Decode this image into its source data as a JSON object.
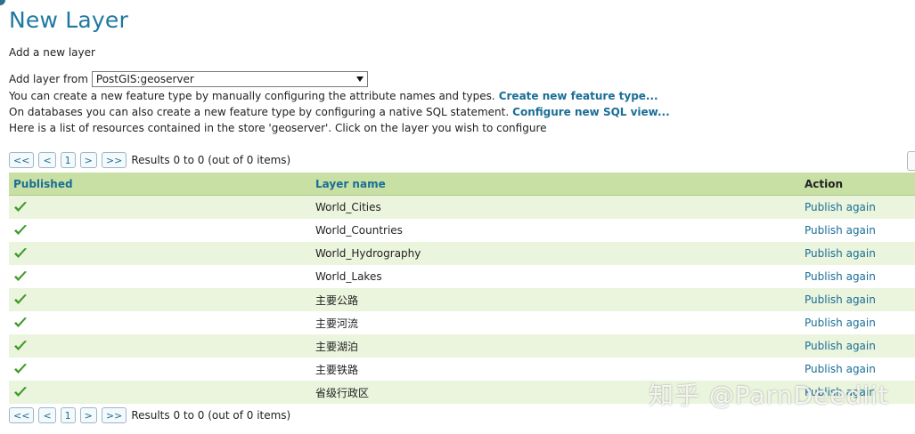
{
  "page": {
    "title": "New Layer",
    "subtitle": "Add a new layer"
  },
  "add_from": {
    "label": "Add layer from",
    "selected_store": "PostGIS:geoserver"
  },
  "info": {
    "line1_text": "You can create a new feature type by manually configuring the attribute names and types.",
    "line1_link": "Create new feature type...",
    "line2_text": "On databases you can also create a new feature type by configuring a native SQL statement.",
    "line2_link": "Configure new SQL view...",
    "line3_text": "Here is a list of resources contained in the store 'geoserver'. Click on the layer you wish to configure"
  },
  "pager": {
    "first": "<<",
    "prev": "<",
    "page": "1",
    "next": ">",
    "last": ">>",
    "results": "Results 0 to 0 (out of 0 items)"
  },
  "table": {
    "headers": [
      "Published",
      "Layer name",
      "Action"
    ],
    "rows": [
      {
        "name": "World_Cities",
        "action": "Publish again"
      },
      {
        "name": "World_Countries",
        "action": "Publish again"
      },
      {
        "name": "World_Hydrography",
        "action": "Publish again"
      },
      {
        "name": "World_Lakes",
        "action": "Publish again"
      },
      {
        "name": "主要公路",
        "action": "Publish again"
      },
      {
        "name": "主要河流",
        "action": "Publish again"
      },
      {
        "name": "主要湖泊",
        "action": "Publish again"
      },
      {
        "name": "主要铁路",
        "action": "Publish again"
      },
      {
        "name": "省级行政区",
        "action": "Publish again"
      }
    ]
  },
  "watermark": "知乎 @ParnDeedlit",
  "icons": {
    "published": "check-icon",
    "dropdown": "chevron-down-icon"
  },
  "colors": {
    "title": "#1f78a0",
    "link": "#1a6e96",
    "header_bg": "#c8e0a4",
    "row_alt_bg": "#ebf4dd",
    "check": "#3f9a2a"
  }
}
